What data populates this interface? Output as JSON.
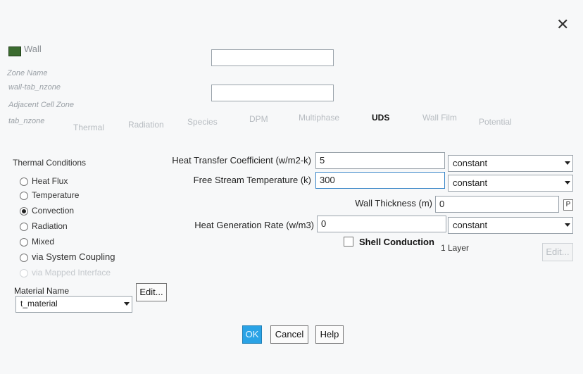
{
  "title": "Wall",
  "zone_name_label": "Zone Name",
  "zone_name_value": "wall-tab_nzone",
  "adjacent_cell_zone_label": "Adjacent Cell Zone",
  "adjacent_cell_zone_value": "tab_nzone",
  "tabs": [
    "Thermal",
    "Radiation",
    "Species",
    "DPM",
    "Multiphase",
    "UDS",
    "Wall Film",
    "Potential"
  ],
  "active_tab": "UDS",
  "thermal_conditions_title": "Thermal Conditions",
  "thermal_conditions": [
    {
      "label": "Heat Flux",
      "checked": false
    },
    {
      "label": "Temperature",
      "checked": false
    },
    {
      "label": "Convection",
      "checked": true
    },
    {
      "label": "Radiation",
      "checked": false
    },
    {
      "label": "Mixed",
      "checked": false
    },
    {
      "label": "via System Coupling",
      "checked": false
    },
    {
      "label": "via Mapped Interface",
      "checked": false
    }
  ],
  "material_name_label": "Material Name",
  "material_name_value": "t_material",
  "edit_button": "Edit...",
  "fields": {
    "heat_transfer_coefficient_label": "Heat Transfer Coefficient (w/m2-k)",
    "heat_transfer_coefficient_value": "5",
    "heat_transfer_coefficient_method": "constant",
    "free_stream_temperature_label": "Free Stream Temperature (k)",
    "free_stream_temperature_value": "300",
    "free_stream_temperature_method": "constant",
    "wall_thickness_label": "Wall Thickness (m)",
    "wall_thickness_value": "0",
    "wall_thickness_param": "P",
    "heat_generation_rate_label": "Heat Generation Rate (w/m3)",
    "heat_generation_rate_value": "0",
    "heat_generation_rate_method": "constant",
    "shell_conduction_label": "Shell Conduction",
    "shell_conduction_checked": false,
    "layers_text": "1 Layer",
    "layers_edit": "Edit..."
  },
  "buttons": {
    "ok": "OK",
    "cancel": "Cancel",
    "help": "Help"
  }
}
